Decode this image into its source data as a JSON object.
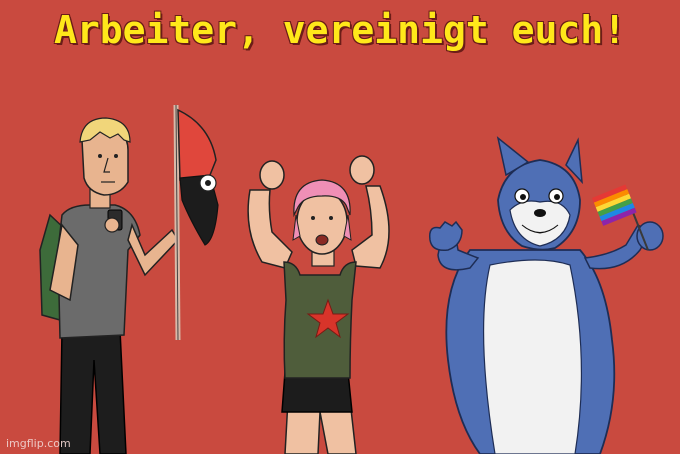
{
  "caption": "Arbeiter, vereinigt euch!",
  "watermark": "imgflip.com",
  "colors": {
    "background": "#c94a3f",
    "caption_text": "#ffe81a",
    "caption_outline": "#6b1d18",
    "flag_red": "#e0473c",
    "flag_black": "#1c1c1c",
    "furry_blue": "#4f6fb5",
    "furry_white": "#f2f2f2",
    "tank_top": "#4f5d3b",
    "hair_pink": "#ef8fb6"
  },
  "icons": [
    "red-black-flag-icon",
    "rainbow-flag-icon",
    "red-star-icon"
  ]
}
